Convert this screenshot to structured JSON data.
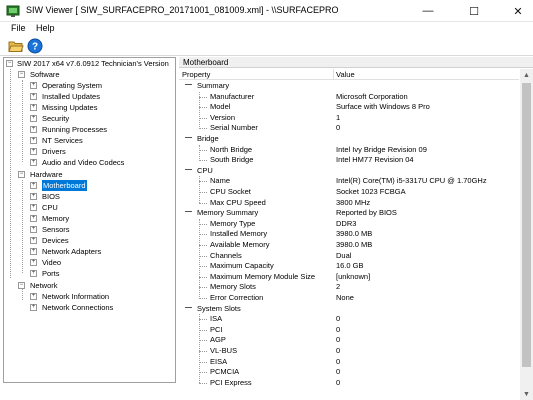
{
  "window": {
    "title": "SIW Viewer [ SIW_SURFACEPRO_20171001_081009.xml] - \\\\SURFACEPRO",
    "minimize_glyph": "—",
    "maximize_glyph": "☐",
    "close_glyph": "✕"
  },
  "menu": {
    "file": "File",
    "help": "Help"
  },
  "toolbar": {
    "open_icon": "folder-open-icon",
    "help_icon": "help-icon"
  },
  "tree": {
    "root": "SIW 2017 x64 v7.6.0912 Technician's Version",
    "software": {
      "label": "Software",
      "items": [
        "Operating System",
        "Installed Updates",
        "Missing Updates",
        "Security",
        "Running Processes",
        "NT Services",
        "Drivers",
        "Audio and Video Codecs"
      ]
    },
    "hardware": {
      "label": "Hardware",
      "items": [
        "Motherboard",
        "BIOS",
        "CPU",
        "Memory",
        "Sensors",
        "Devices",
        "Network Adapters",
        "Video",
        "Ports"
      ]
    },
    "network": {
      "label": "Network",
      "items": [
        "Network Information",
        "Network Connections"
      ]
    },
    "selected": "Motherboard"
  },
  "details": {
    "section_title": "Motherboard",
    "columns": {
      "property": "Property",
      "value": "Value"
    },
    "rows": [
      {
        "type": "cat",
        "prop": "Summary",
        "val": ""
      },
      {
        "type": "item",
        "prop": "Manufacturer",
        "val": "Microsoft Corporation"
      },
      {
        "type": "item",
        "prop": "Model",
        "val": "Surface with Windows 8 Pro"
      },
      {
        "type": "item",
        "prop": "Version",
        "val": "1"
      },
      {
        "type": "item",
        "prop": "Serial Number",
        "val": "0"
      },
      {
        "type": "cat",
        "prop": "Bridge",
        "val": ""
      },
      {
        "type": "item",
        "prop": "North Bridge",
        "val": "Intel Ivy Bridge Revision 09"
      },
      {
        "type": "item",
        "prop": "South Bridge",
        "val": "Intel HM77 Revision 04"
      },
      {
        "type": "cat",
        "prop": "CPU",
        "val": ""
      },
      {
        "type": "item",
        "prop": "Name",
        "val": "Intel(R) Core(TM) i5-3317U CPU @ 1.70GHz"
      },
      {
        "type": "item",
        "prop": "CPU Socket",
        "val": "Socket 1023 FCBGA"
      },
      {
        "type": "item",
        "prop": "Max CPU Speed",
        "val": "3800 MHz"
      },
      {
        "type": "cat",
        "prop": "Memory Summary",
        "val": "Reported by BIOS"
      },
      {
        "type": "item",
        "prop": "Memory Type",
        "val": "DDR3"
      },
      {
        "type": "item",
        "prop": "Installed Memory",
        "val": "3980.0 MB"
      },
      {
        "type": "item",
        "prop": "Available Memory",
        "val": "3980.0 MB"
      },
      {
        "type": "item",
        "prop": "Channels",
        "val": "Dual"
      },
      {
        "type": "item",
        "prop": "Maximum Capacity",
        "val": "16.0 GB"
      },
      {
        "type": "item",
        "prop": "Maximum Memory Module Size",
        "val": "[unknown]"
      },
      {
        "type": "item",
        "prop": "Memory Slots",
        "val": "2"
      },
      {
        "type": "item",
        "prop": "Error Correction",
        "val": "None"
      },
      {
        "type": "cat",
        "prop": "System Slots",
        "val": ""
      },
      {
        "type": "item",
        "prop": "ISA",
        "val": "0"
      },
      {
        "type": "item",
        "prop": "PCI",
        "val": "0"
      },
      {
        "type": "item",
        "prop": "AGP",
        "val": "0"
      },
      {
        "type": "item",
        "prop": "VL-BUS",
        "val": "0"
      },
      {
        "type": "item",
        "prop": "EISA",
        "val": "0"
      },
      {
        "type": "item",
        "prop": "PCMCIA",
        "val": "0"
      },
      {
        "type": "item",
        "prop": "PCI Express",
        "val": "0"
      }
    ]
  }
}
